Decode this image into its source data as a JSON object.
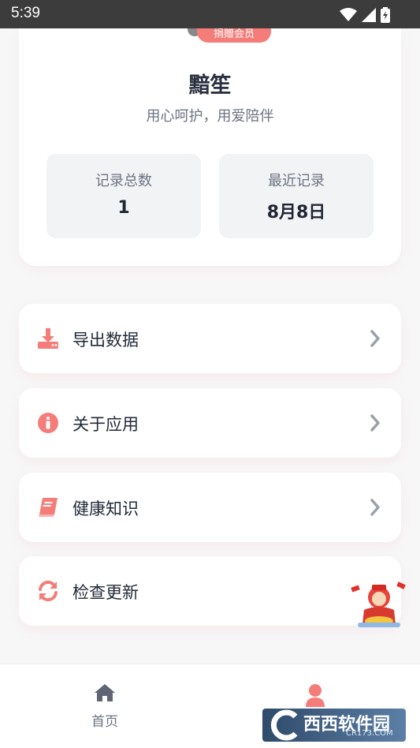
{
  "status_bar": {
    "time": "5:39"
  },
  "profile": {
    "badge_label": "捐赠会员",
    "name": "黯笙",
    "motto": "用心呵护，用爱陪伴",
    "stats": [
      {
        "label": "记录总数",
        "value": "1"
      },
      {
        "label": "最近记录",
        "value": "8月8日"
      }
    ]
  },
  "menu": {
    "items": [
      {
        "label": "导出数据",
        "icon": "download-icon"
      },
      {
        "label": "关于应用",
        "icon": "info-icon"
      },
      {
        "label": "健康知识",
        "icon": "book-icon"
      },
      {
        "label": "检查更新",
        "icon": "refresh-icon"
      }
    ]
  },
  "bottom_nav": {
    "home_label": "首页",
    "active_tab": "profile"
  },
  "watermark": {
    "text": "西西软件园",
    "sub": "CR173.COM"
  },
  "colors": {
    "accent": "#f47d79",
    "text_dark": "#222a38",
    "text_muted": "#6c7383"
  }
}
